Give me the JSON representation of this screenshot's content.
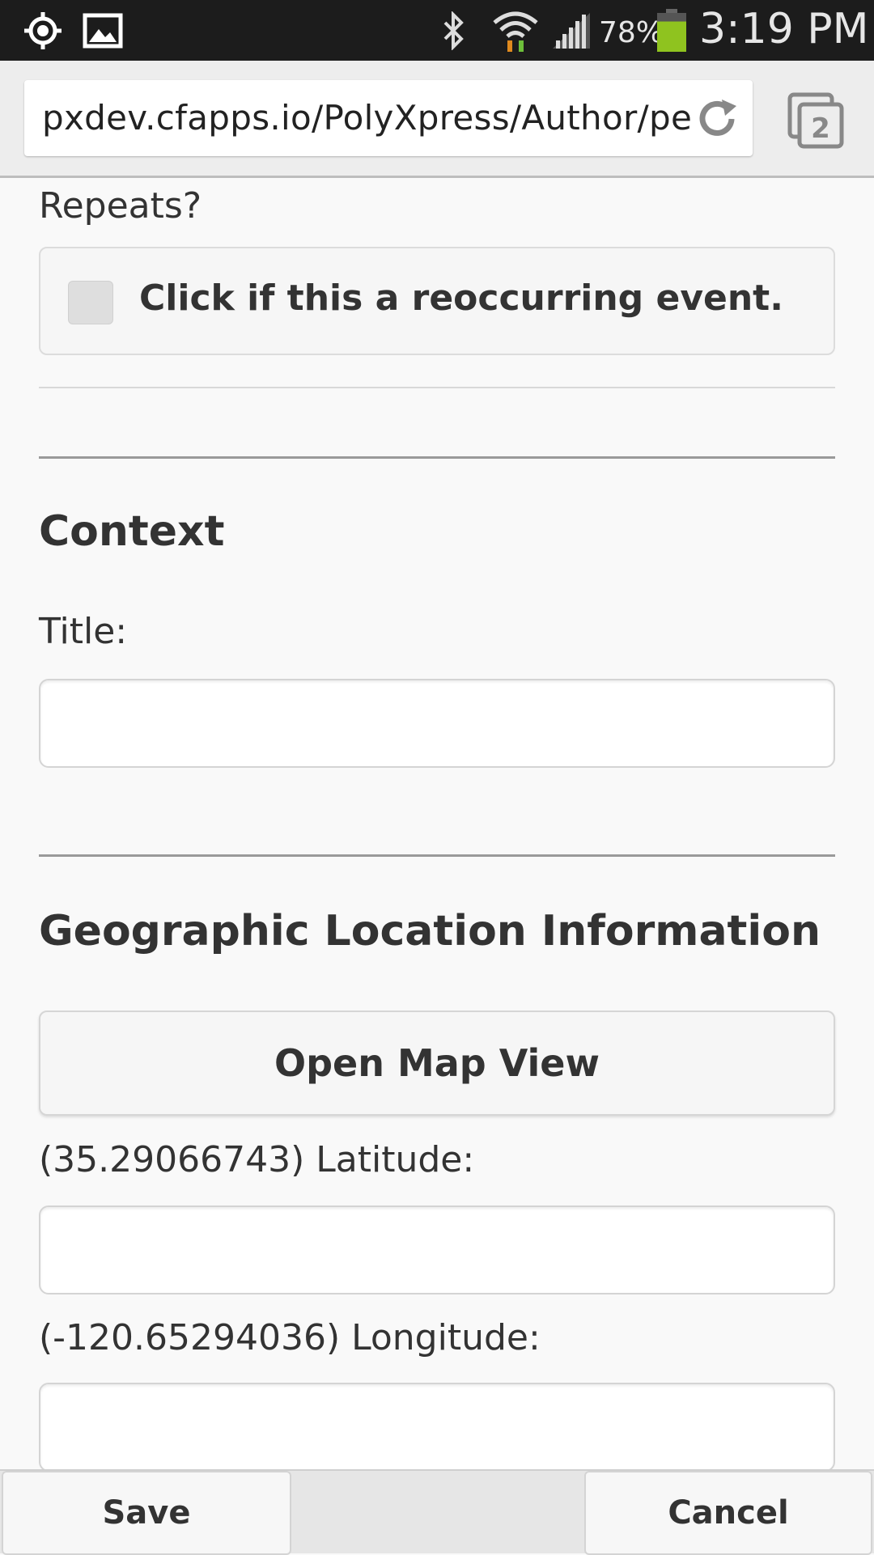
{
  "status_bar": {
    "battery_percent": "78%",
    "time": "3:19 PM",
    "icons": [
      "location-icon",
      "gallery-icon",
      "bluetooth-icon",
      "wifi-icon",
      "signal-icon",
      "battery-icon"
    ],
    "battery_level": 0.78,
    "battery_color": "#8fc31f"
  },
  "browser": {
    "url": "pxdev.cfapps.io/PolyXpress/Author/pe",
    "tab_count": "2"
  },
  "form": {
    "repeats_label": "Repeats?",
    "repeats_checkbox_label": "Click if this a reoccurring event.",
    "repeats_checked": false,
    "context_heading": "Context",
    "title_label": "Title:",
    "title_value": "",
    "geo_heading": "Geographic Location Information",
    "open_map_label": "Open Map View",
    "latitude_label": "(35.29066743) Latitude:",
    "latitude_value": "",
    "longitude_label": "(-120.65294036) Longitude:",
    "longitude_value": ""
  },
  "footer": {
    "save_label": "Save",
    "cancel_label": "Cancel"
  }
}
